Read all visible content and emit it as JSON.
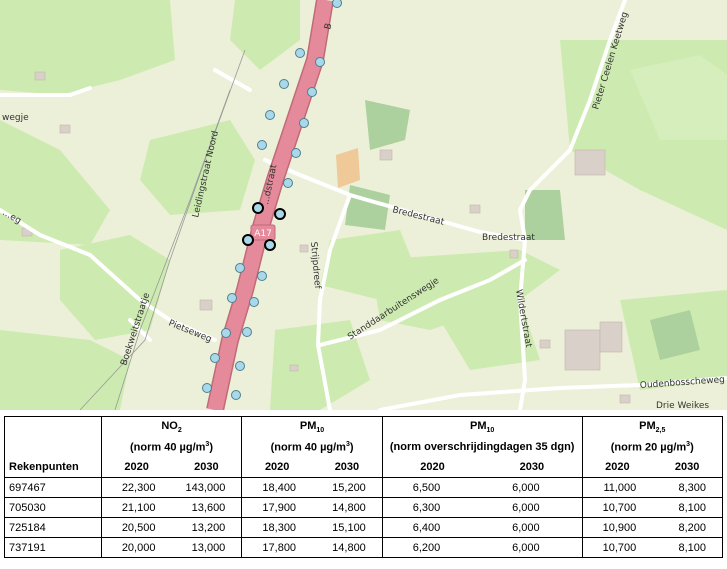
{
  "map": {
    "road_shield": "A17",
    "streets": {
      "leidingstraat_noord": "Leidingstraat Noord",
      "wegje": "wegje",
      "bredestraat_1": "Bredestraat",
      "bredestraat_2": "Bredestraat",
      "pieter_ceelen": "Pieter Ceelen Keetweg",
      "stadstraat": "...dstraat",
      "strijpdreef": "Strijpdreef",
      "standaardbuitenswegje": "Standdaarbuitenswegje",
      "wildertstraat": "Wildertstraat",
      "oudenbosscheweg": "Oudenbosscheweg",
      "drie_weikes": "Drie Weikes",
      "boekweitstraatje": "Boekweitstraatje",
      "pietseweg": "Pietseweg",
      "left_edge": "...eg",
      "top_b": "B"
    },
    "colors": {
      "highway": "#e58a9a",
      "meadow": "#cdebb0",
      "background": "#edf0d8",
      "receptor_marker": "#a9d8e8"
    }
  },
  "table": {
    "groups": [
      {
        "label": "NO",
        "sub": "2",
        "norm_pre": "(norm 40 µg/m",
        "norm_sup": "3",
        "norm_post": ")"
      },
      {
        "label": "PM",
        "sub": "10",
        "norm_pre": "(norm 40 µg/m",
        "norm_sup": "3",
        "norm_post": ")"
      },
      {
        "label": "PM",
        "sub": "10",
        "norm_pre": "(norm overschrijdingdagen 35 dgn)",
        "norm_sup": "",
        "norm_post": ""
      },
      {
        "label": "PM",
        "sub": "2,5",
        "norm_pre": "(norm 20 µg/m",
        "norm_sup": "3",
        "norm_post": ")"
      }
    ],
    "row_header": "Rekenpunten",
    "years": [
      "2020",
      "2030",
      "2020",
      "2030",
      "2020",
      "2030",
      "2020",
      "2030"
    ],
    "rows": [
      {
        "id": "697467",
        "values": [
          "22,300",
          "143,000",
          "18,400",
          "15,200",
          "6,500",
          "6,000",
          "11,000",
          "8,300"
        ]
      },
      {
        "id": "705030",
        "values": [
          "21,100",
          "13,600",
          "17,900",
          "14,800",
          "6,300",
          "6,000",
          "10,700",
          "8,100"
        ]
      },
      {
        "id": "725184",
        "values": [
          "20,500",
          "13,200",
          "18,300",
          "15,100",
          "6,400",
          "6,000",
          "10,900",
          "8,200"
        ]
      },
      {
        "id": "737191",
        "values": [
          "20,000",
          "13,000",
          "17,800",
          "14,800",
          "6,200",
          "6,000",
          "10,700",
          "8,100"
        ]
      }
    ]
  }
}
